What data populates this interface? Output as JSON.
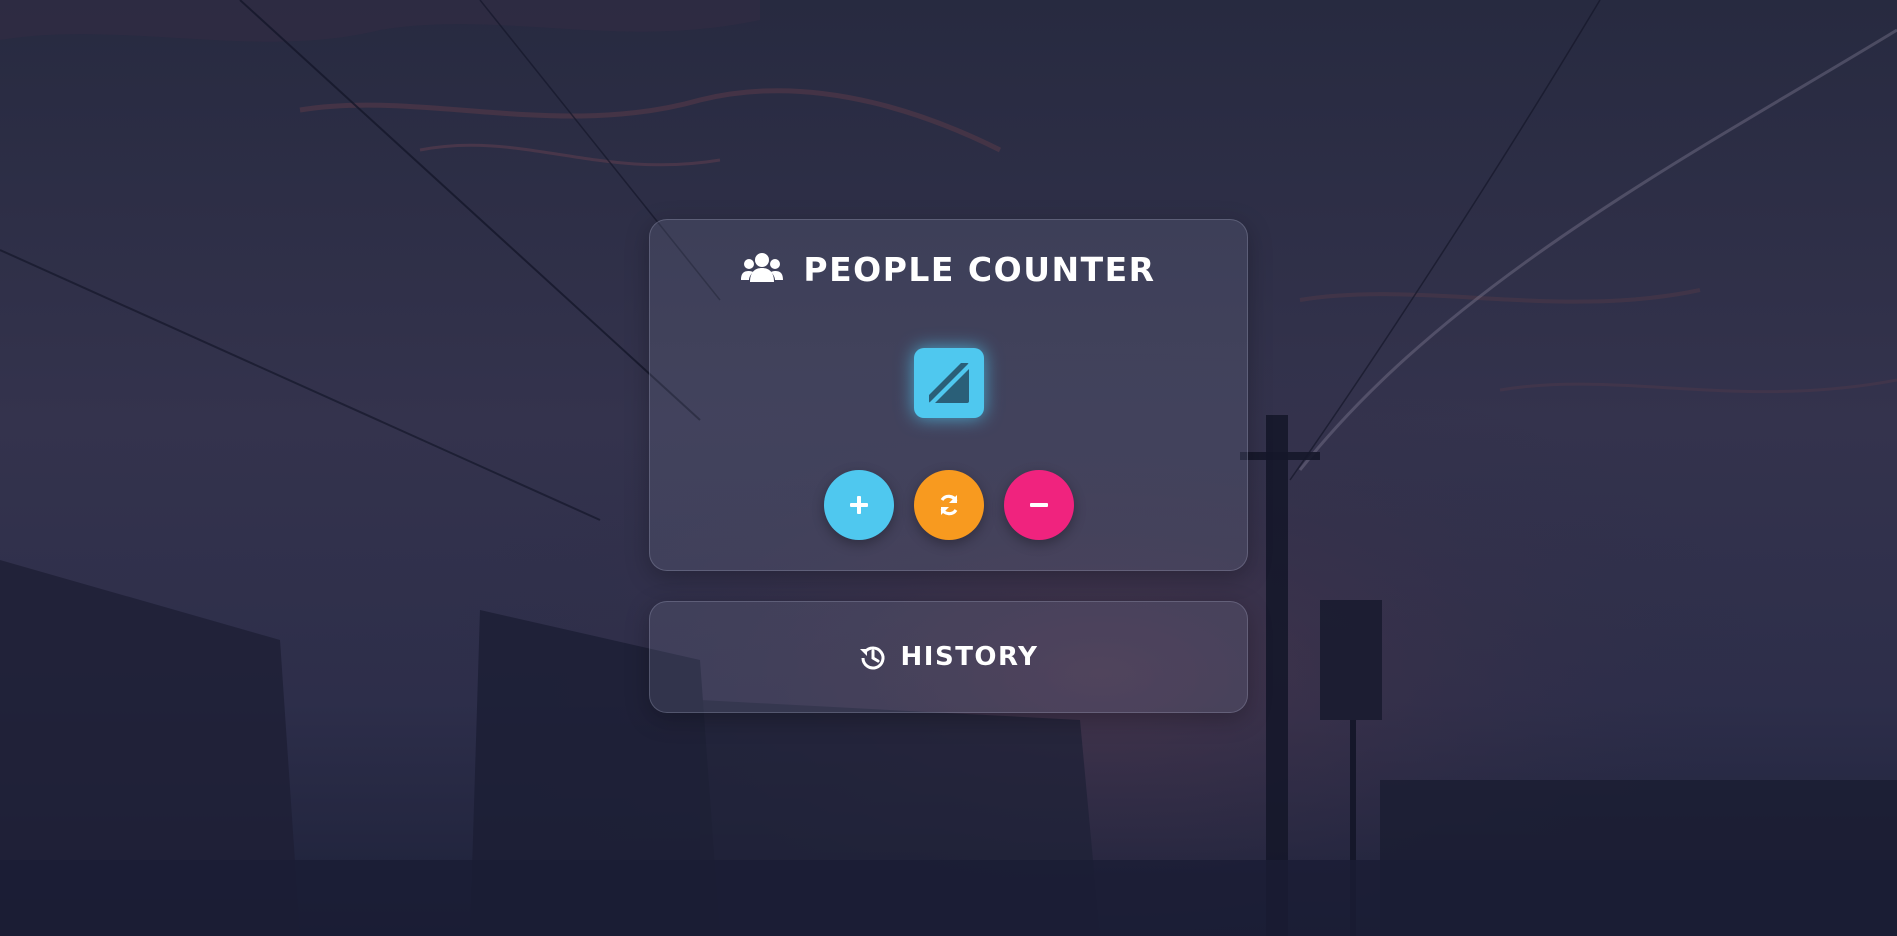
{
  "app": {
    "title": "PEOPLE COUNTER",
    "title_icon": "users-icon"
  },
  "counter": {
    "display_icon": "slash-square-icon"
  },
  "controls": {
    "increment_icon": "plus-icon",
    "reset_icon": "refresh-icon",
    "decrement_icon": "minus-icon"
  },
  "history": {
    "label": "HISTORY",
    "icon": "history-icon"
  },
  "colors": {
    "accent_blue": "#4fc8ef",
    "accent_orange": "#f89a1f",
    "accent_pink": "#f0237e",
    "text": "#ffffff"
  }
}
